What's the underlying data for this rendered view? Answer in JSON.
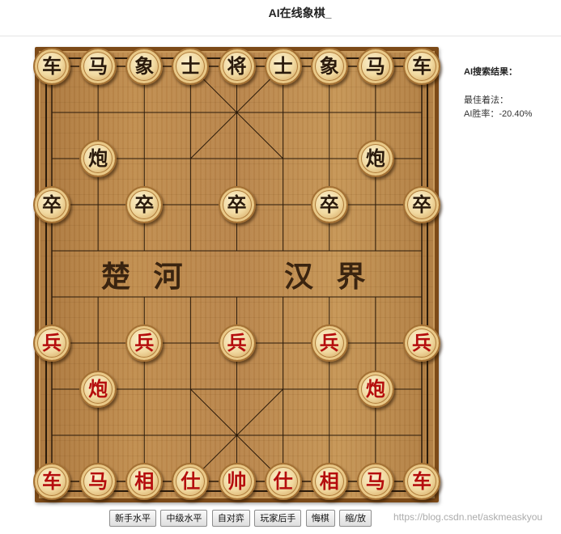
{
  "title": "AI在线象棋_",
  "board": {
    "river_left": "楚 河",
    "river_right": "汉 界"
  },
  "pieces": [
    {
      "color": "black",
      "label": "车",
      "file": 0,
      "rank": 0
    },
    {
      "color": "black",
      "label": "马",
      "file": 1,
      "rank": 0
    },
    {
      "color": "black",
      "label": "象",
      "file": 2,
      "rank": 0
    },
    {
      "color": "black",
      "label": "士",
      "file": 3,
      "rank": 0
    },
    {
      "color": "black",
      "label": "将",
      "file": 4,
      "rank": 0
    },
    {
      "color": "black",
      "label": "士",
      "file": 5,
      "rank": 0
    },
    {
      "color": "black",
      "label": "象",
      "file": 6,
      "rank": 0
    },
    {
      "color": "black",
      "label": "马",
      "file": 7,
      "rank": 0
    },
    {
      "color": "black",
      "label": "车",
      "file": 8,
      "rank": 0
    },
    {
      "color": "black",
      "label": "炮",
      "file": 1,
      "rank": 2
    },
    {
      "color": "black",
      "label": "炮",
      "file": 7,
      "rank": 2
    },
    {
      "color": "black",
      "label": "卒",
      "file": 0,
      "rank": 3
    },
    {
      "color": "black",
      "label": "卒",
      "file": 2,
      "rank": 3
    },
    {
      "color": "black",
      "label": "卒",
      "file": 4,
      "rank": 3
    },
    {
      "color": "black",
      "label": "卒",
      "file": 6,
      "rank": 3
    },
    {
      "color": "black",
      "label": "卒",
      "file": 8,
      "rank": 3
    },
    {
      "color": "red",
      "label": "兵",
      "file": 0,
      "rank": 6
    },
    {
      "color": "red",
      "label": "兵",
      "file": 2,
      "rank": 6
    },
    {
      "color": "red",
      "label": "兵",
      "file": 4,
      "rank": 6
    },
    {
      "color": "red",
      "label": "兵",
      "file": 6,
      "rank": 6
    },
    {
      "color": "red",
      "label": "兵",
      "file": 8,
      "rank": 6
    },
    {
      "color": "red",
      "label": "炮",
      "file": 1,
      "rank": 7
    },
    {
      "color": "red",
      "label": "炮",
      "file": 7,
      "rank": 7
    },
    {
      "color": "red",
      "label": "车",
      "file": 0,
      "rank": 9
    },
    {
      "color": "red",
      "label": "马",
      "file": 1,
      "rank": 9
    },
    {
      "color": "red",
      "label": "相",
      "file": 2,
      "rank": 9
    },
    {
      "color": "red",
      "label": "仕",
      "file": 3,
      "rank": 9
    },
    {
      "color": "red",
      "label": "帅",
      "file": 4,
      "rank": 9
    },
    {
      "color": "red",
      "label": "仕",
      "file": 5,
      "rank": 9
    },
    {
      "color": "red",
      "label": "相",
      "file": 6,
      "rank": 9
    },
    {
      "color": "red",
      "label": "马",
      "file": 7,
      "rank": 9
    },
    {
      "color": "red",
      "label": "车",
      "file": 8,
      "rank": 9
    }
  ],
  "panel": {
    "heading": "AI搜索结果：",
    "best_move": "最佳着法：",
    "win_rate": "AI胜率：-20.40%"
  },
  "buttons": [
    "新手水平",
    "中级水平",
    "自对弈",
    "玩家后手",
    "悔棋",
    "缩/放"
  ],
  "watermark": "https://blog.csdn.net/askmeaskyou",
  "colors": {
    "red_piece_text": "#b50d0d",
    "black_piece_text": "#2a1a0c",
    "board_wood": "#c08d4f",
    "board_frame": "#7c4a18"
  }
}
